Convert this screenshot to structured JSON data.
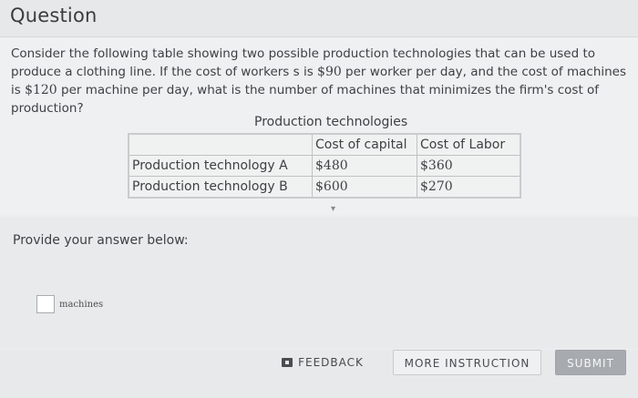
{
  "header": {
    "title": "Question"
  },
  "question": {
    "text_part1": "Consider the following table showing two possible production technologies that can be used to produce a clothing line.  If the cost of workers s is ",
    "worker_cost": "$90",
    "text_part2": " per worker per day,  and the cost of machines is ",
    "machine_cost": "$120",
    "text_part3": " per machine per day, what is the number of machines that minimizes the firm's cost of production?"
  },
  "table": {
    "caption": "Production technologies",
    "headers": [
      "",
      "Cost of capital",
      "Cost of Labor"
    ],
    "rows": [
      [
        "Production technology A",
        "$480",
        "$360"
      ],
      [
        "Production technology B",
        "$600",
        "$270"
      ]
    ]
  },
  "answer": {
    "prompt": "Provide your answer below:",
    "value": "",
    "unit": "machines"
  },
  "footer": {
    "feedback_label": "FEEDBACK",
    "instruction_label": "MORE INSTRUCTION",
    "submit_label": "SUBMIT"
  },
  "icons": {
    "feedback": "feedback-icon"
  }
}
